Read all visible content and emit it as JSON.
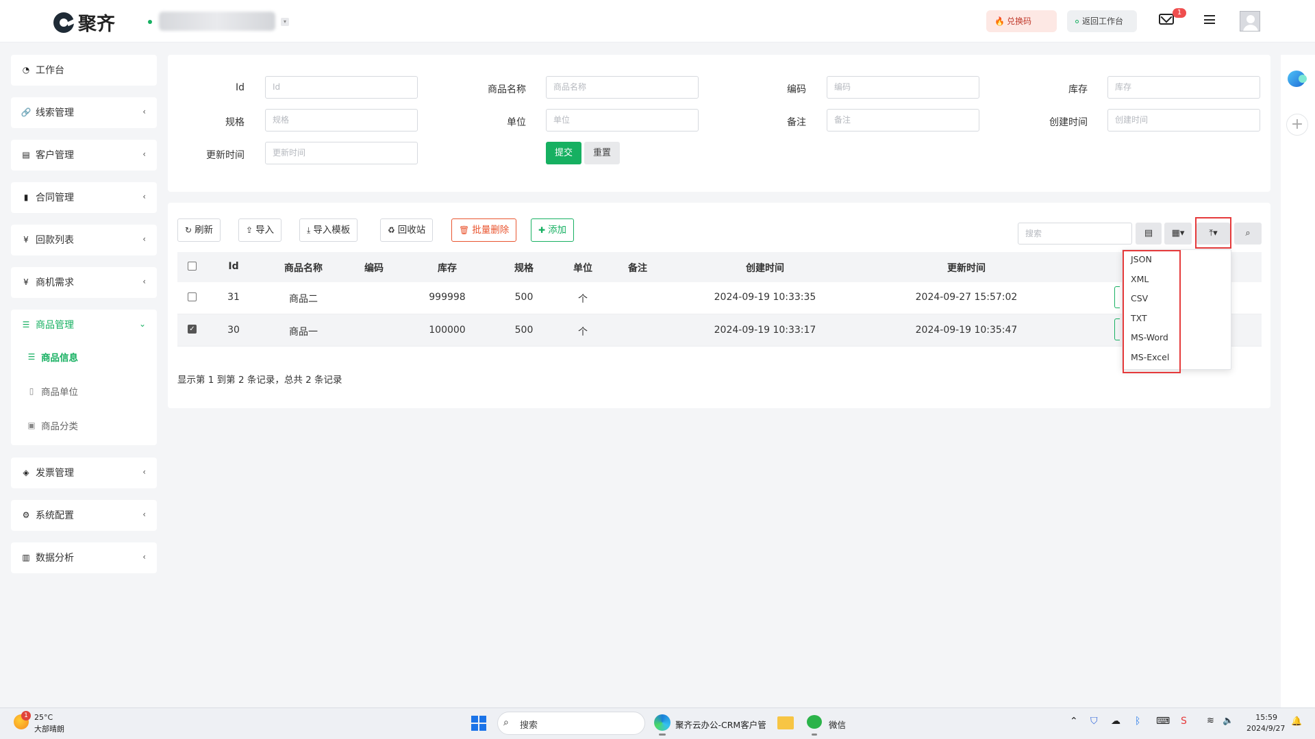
{
  "header": {
    "brand": "聚齐",
    "redeem_label": "兑换码",
    "back_label": "返回工作台",
    "mail_count": "1"
  },
  "sidebar": {
    "items": [
      {
        "label": "工作台",
        "icon": "dashboard-icon"
      },
      {
        "label": "线索管理",
        "icon": "link-icon"
      },
      {
        "label": "客户管理",
        "icon": "id-card-icon"
      },
      {
        "label": "合同管理",
        "icon": "bookmark-icon"
      },
      {
        "label": "回款列表",
        "icon": "yen-icon"
      },
      {
        "label": "商机需求",
        "icon": "yen-icon"
      },
      {
        "label": "商品管理",
        "icon": "list-icon"
      },
      {
        "label": "发票管理",
        "icon": "ticket-icon"
      },
      {
        "label": "系统配置",
        "icon": "cogs-icon"
      },
      {
        "label": "数据分析",
        "icon": "bar-chart-icon"
      }
    ],
    "sub_items": [
      {
        "label": "商品信息",
        "icon": "list-icon"
      },
      {
        "label": "商品单位",
        "icon": "book-icon"
      },
      {
        "label": "商品分类",
        "icon": "calendar-icon"
      }
    ]
  },
  "form": {
    "fields": [
      {
        "label": "Id",
        "placeholder": "Id"
      },
      {
        "label": "商品名称",
        "placeholder": "商品名称"
      },
      {
        "label": "编码",
        "placeholder": "编码"
      },
      {
        "label": "库存",
        "placeholder": "库存"
      },
      {
        "label": "规格",
        "placeholder": "规格"
      },
      {
        "label": "单位",
        "placeholder": "单位"
      },
      {
        "label": "备注",
        "placeholder": "备注"
      },
      {
        "label": "创建时间",
        "placeholder": "创建时间"
      },
      {
        "label": "更新时间",
        "placeholder": "更新时间"
      }
    ],
    "submit_label": "提交",
    "reset_label": "重置"
  },
  "toolbar": {
    "refresh": "刷新",
    "import": "导入",
    "import_template": "导入模板",
    "recycle": "回收站",
    "batch_delete": "批量删除",
    "add": "添加",
    "search_placeholder": "搜索"
  },
  "table": {
    "columns": [
      "Id",
      "商品名称",
      "编码",
      "库存",
      "规格",
      "单位",
      "备注",
      "创建时间",
      "更新时间"
    ],
    "rows": [
      {
        "id": "31",
        "name": "商品二",
        "code": "",
        "stock": "999998",
        "spec": "500",
        "unit": "个",
        "note": "",
        "created": "2024-09-19 10:33:35",
        "updated": "2024-09-27 15:57:02",
        "checked": false
      },
      {
        "id": "30",
        "name": "商品一",
        "code": "",
        "stock": "100000",
        "spec": "500",
        "unit": "个",
        "note": "",
        "created": "2024-09-19 10:33:17",
        "updated": "2024-09-19 10:35:47",
        "checked": true
      }
    ],
    "pager_text": "显示第 1 到第 2 条记录，总共 2 条记录"
  },
  "export_menu": [
    "JSON",
    "XML",
    "CSV",
    "TXT",
    "MS-Word",
    "MS-Excel"
  ],
  "taskbar": {
    "temp": "25°C",
    "weather": "大部晴朗",
    "weather_badge": "1",
    "search_label": "搜索",
    "app_title": "聚齐云办公-CRM客户管",
    "wechat": "微信",
    "time": "15:59",
    "date": "2024/9/27"
  },
  "colors": {
    "accent": "#16b061",
    "danger": "#e9542e",
    "highlight": "#e5393a"
  }
}
